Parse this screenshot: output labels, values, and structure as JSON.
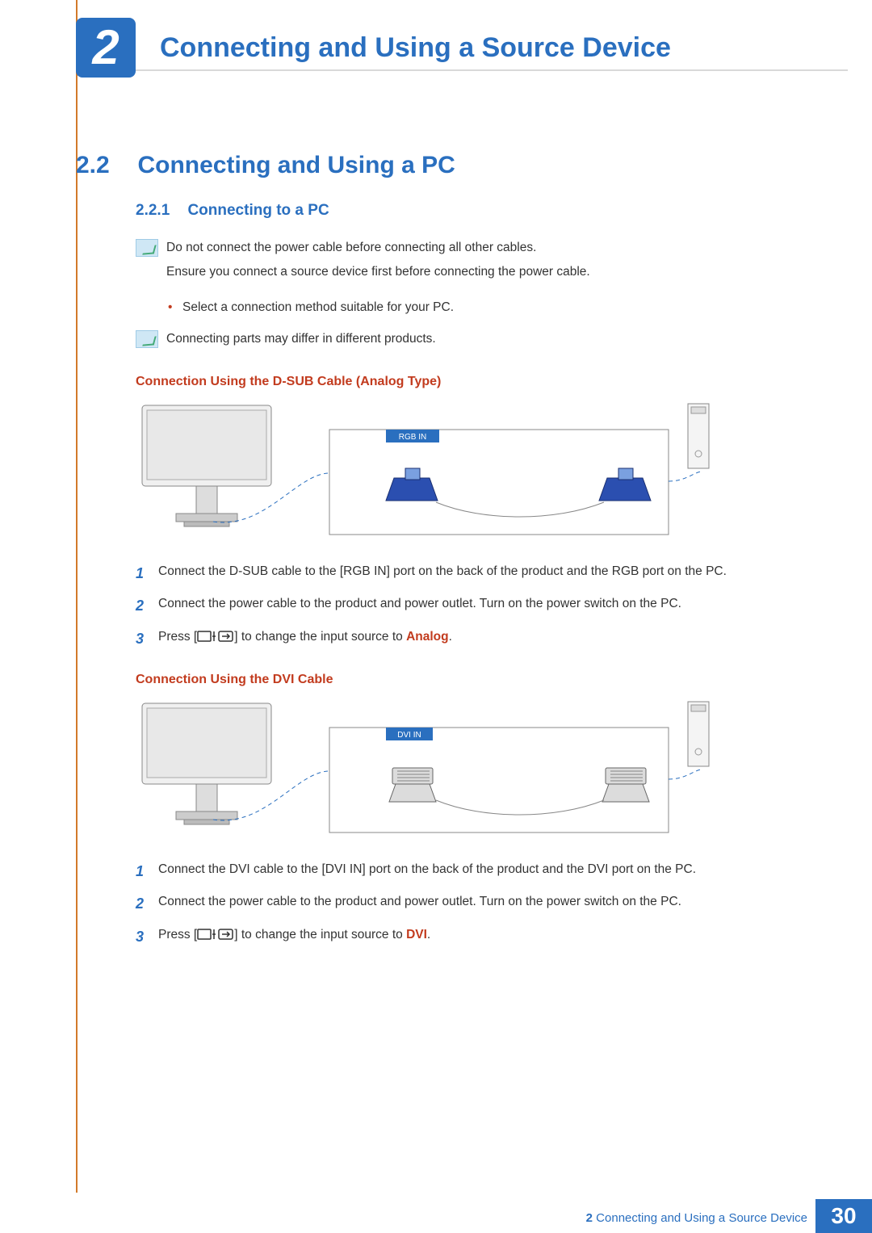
{
  "chapter": {
    "number": "2",
    "title": "Connecting and Using a Source Device"
  },
  "section": {
    "number": "2.2",
    "title": "Connecting and Using a PC"
  },
  "subsection": {
    "number": "2.2.1",
    "title": "Connecting to a PC"
  },
  "notes": {
    "a_line1": "Do not connect the power cable before connecting all other cables.",
    "a_line2": "Ensure you connect a source device first before connecting the power cable.",
    "bullet": "Select a connection method suitable for your PC.",
    "b": "Connecting parts may differ in different products."
  },
  "dsub": {
    "heading": "Connection Using the D-SUB Cable (Analog Type)",
    "port_label": "RGB IN",
    "steps": {
      "s1": "Connect the D-SUB cable to the [RGB IN] port on the back of the product and the RGB port on the PC.",
      "s2": "Connect the power cable to the product and power outlet. Turn on the power switch on the PC.",
      "s3_pre": "Press [",
      "s3_post": "] to change the input source to ",
      "s3_val": "Analog",
      "s3_end": "."
    }
  },
  "dvi": {
    "heading": "Connection Using the DVI Cable",
    "port_label": "DVI IN",
    "steps": {
      "s1": "Connect the DVI cable to the [DVI IN] port on the back of the product and the DVI port on the PC.",
      "s2": "Connect the power cable to the product and power outlet. Turn on the power switch on the PC.",
      "s3_pre": "Press [",
      "s3_post": "] to change the input source to ",
      "s3_val": "DVI",
      "s3_end": "."
    }
  },
  "footer": {
    "chapter_ref": "2",
    "title_ref": "Connecting and Using a Source Device",
    "page": "30"
  },
  "colors": {
    "brand_blue": "#2a6fbf",
    "accent_orange": "#c23b1e"
  }
}
